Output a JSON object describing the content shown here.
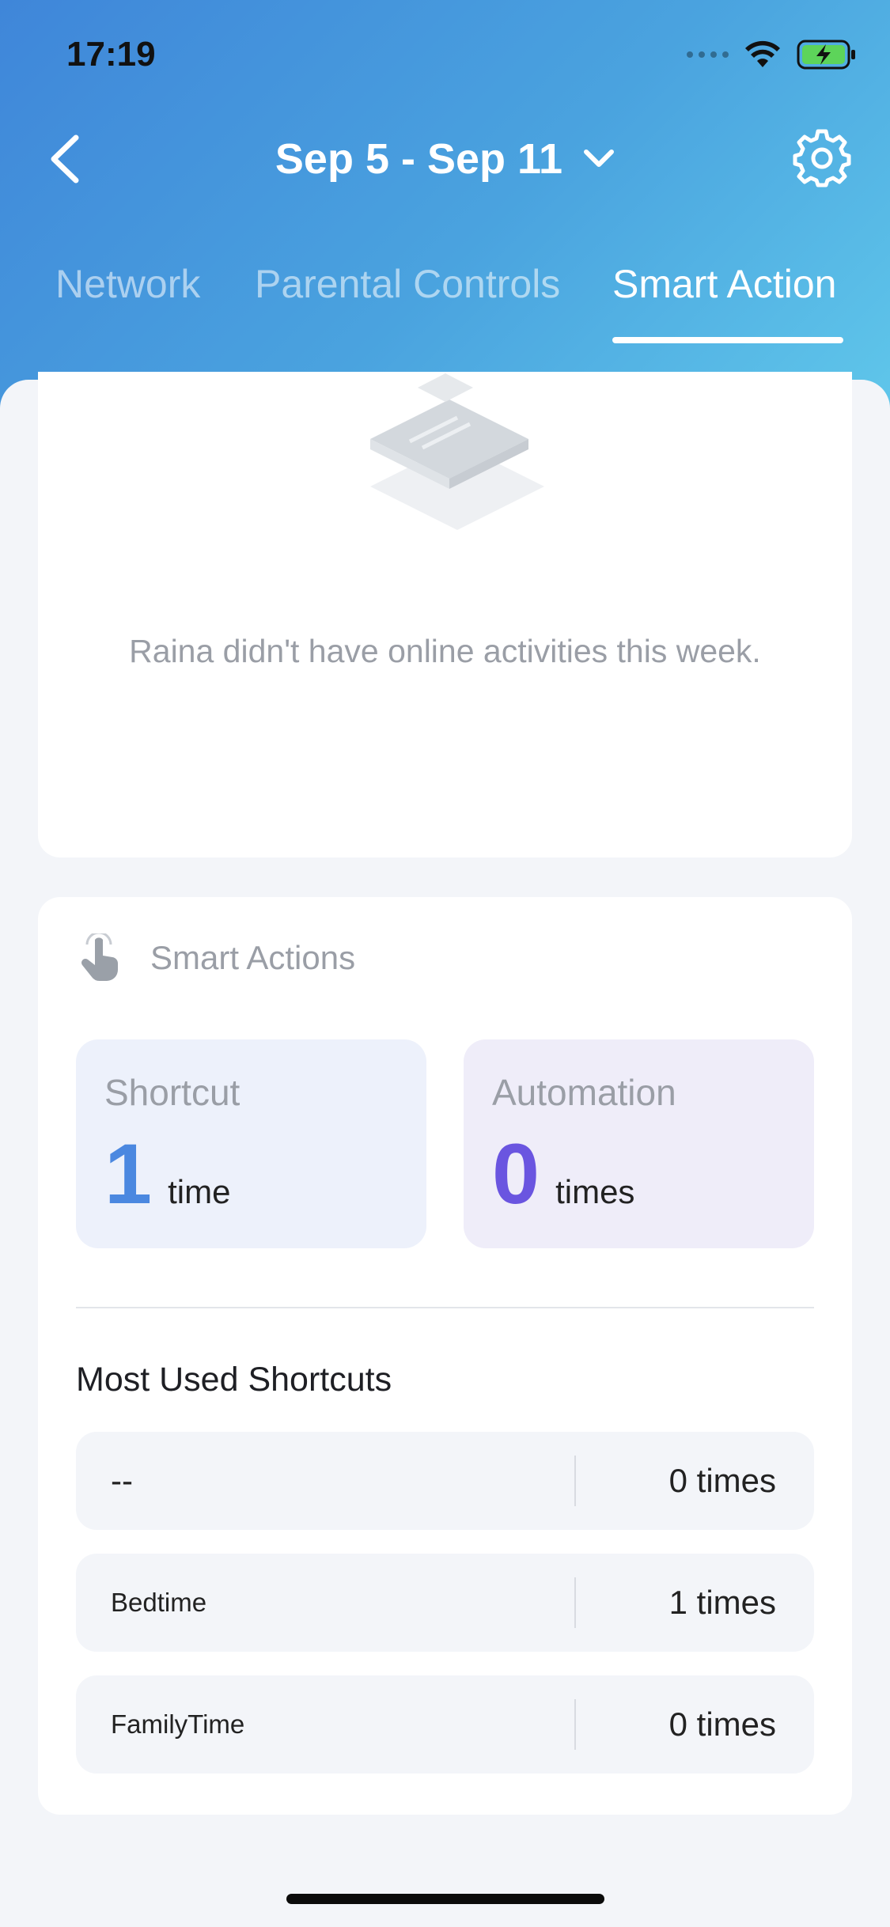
{
  "status_bar": {
    "time": "17:19"
  },
  "nav": {
    "title": "Sep 5 - Sep 11"
  },
  "tabs": [
    {
      "label": "Network",
      "active": false
    },
    {
      "label": "Parental Controls",
      "active": false
    },
    {
      "label": "Smart Action",
      "active": true
    }
  ],
  "empty_state": {
    "message": "Raina didn't have online activities this week."
  },
  "smart_actions": {
    "title": "Smart Actions",
    "shortcut": {
      "label": "Shortcut",
      "count": "1",
      "unit": "time"
    },
    "automation": {
      "label": "Automation",
      "count": "0",
      "unit": "times"
    }
  },
  "most_used": {
    "title": "Most Used Shortcuts",
    "rows": [
      {
        "name": "--",
        "count": "0 times"
      },
      {
        "name": "Bedtime",
        "count": "1 times"
      },
      {
        "name": "FamilyTime",
        "count": "0 times"
      }
    ]
  },
  "colors": {
    "header_gradient_start": "#3f86d9",
    "header_gradient_end": "#5fc6ea",
    "shortcut_accent": "#4b88e0",
    "automation_accent": "#6a55e0"
  }
}
